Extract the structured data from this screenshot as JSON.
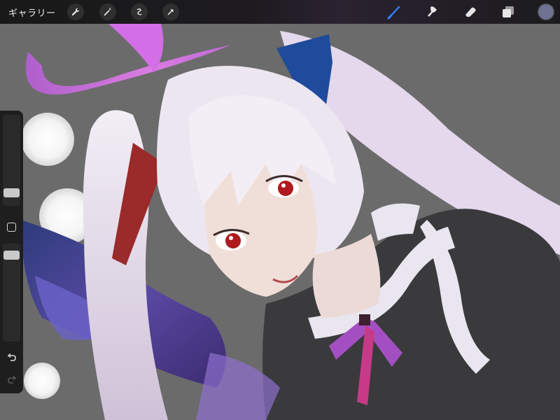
{
  "toolbar": {
    "gallery_label": "ギャラリー",
    "left_tools": [
      "wrench-icon",
      "magic-wand-icon",
      "selection-icon",
      "transform-arrow-icon"
    ],
    "right_tools": [
      "brush-icon",
      "smudge-icon",
      "eraser-icon",
      "layers-icon"
    ],
    "active_tool": "brush-icon",
    "accent_color": "#2d7df6",
    "current_color": "#6f7290"
  },
  "sidebar": {
    "brush_size_level": 0.32,
    "opacity_level": 1.0,
    "buttons": [
      "modify-square-icon",
      "undo-icon",
      "redo-icon"
    ]
  }
}
